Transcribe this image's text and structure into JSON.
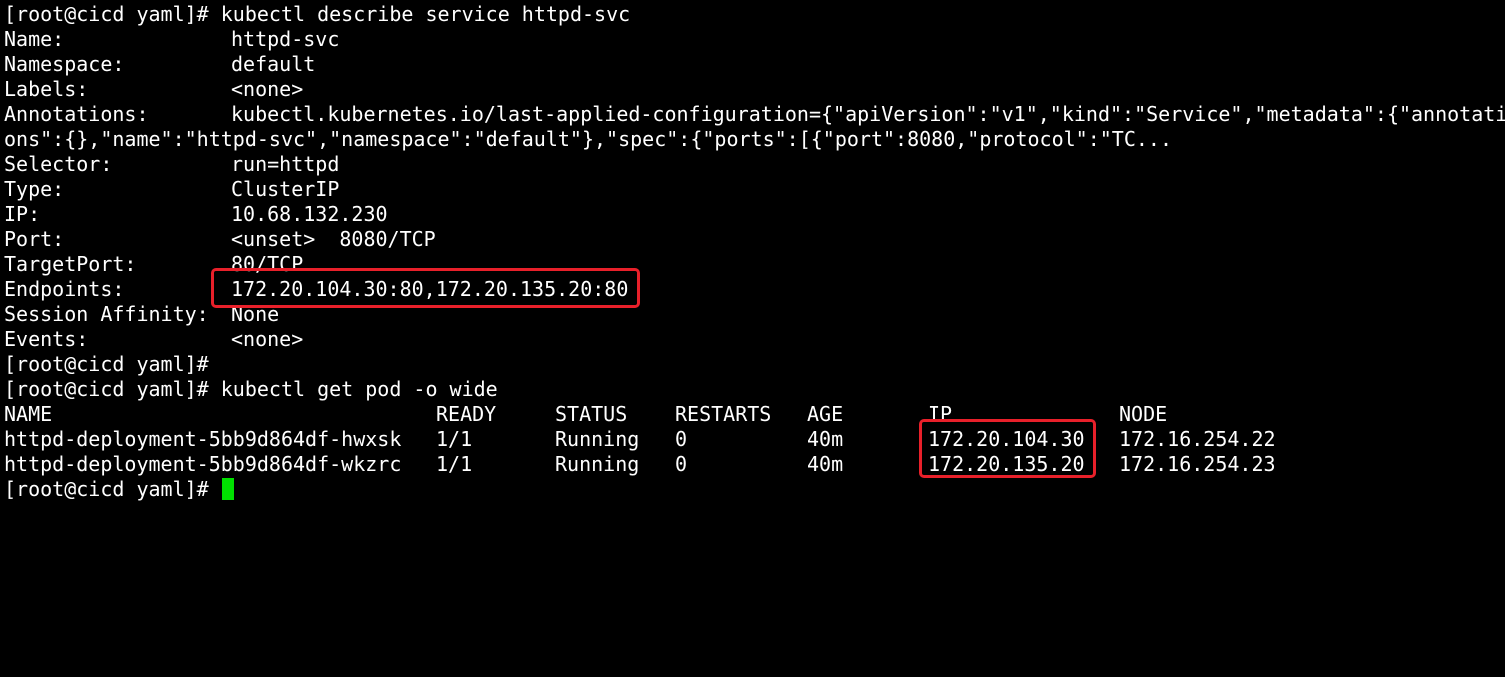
{
  "terminal": {
    "prompt": "[root@cicd yaml]#",
    "cmd_describe": "kubectl describe service httpd-svc",
    "cmd_get_pod": "kubectl get pod -o wide"
  },
  "service": {
    "name_key": "Name:",
    "name_val": "httpd-svc",
    "namespace_key": "Namespace:",
    "namespace_val": "default",
    "labels_key": "Labels:",
    "labels_val": "<none>",
    "annotations_key": "Annotations:",
    "annotations_val": "kubectl.kubernetes.io/last-applied-configuration={\"apiVersion\":\"v1\",\"kind\":\"Service\",\"metadata\":{\"annotati",
    "annotations_cont": "ons\":{},\"name\":\"httpd-svc\",\"namespace\":\"default\"},\"spec\":{\"ports\":[{\"port\":8080,\"protocol\":\"TC...",
    "selector_key": "Selector:",
    "selector_val": "run=httpd",
    "type_key": "Type:",
    "type_val": "ClusterIP",
    "ip_key": "IP:",
    "ip_val": "10.68.132.230",
    "port_key": "Port:",
    "port_val": "<unset>  8080/TCP",
    "targetport_key": "TargetPort:",
    "targetport_val": "80/TCP",
    "endpoints_key": "Endpoints:",
    "endpoints_val": "172.20.104.30:80,172.20.135.20:80",
    "affinity_key": "Session Affinity:",
    "affinity_val": "None",
    "events_key": "Events:",
    "events_val": "<none>"
  },
  "pods": {
    "headers": [
      "NAME",
      "READY",
      "STATUS",
      "RESTARTS",
      "AGE",
      "IP",
      "NODE"
    ],
    "rows": [
      [
        "httpd-deployment-5bb9d864df-hwxsk",
        "1/1",
        "Running",
        "0",
        "40m",
        "172.20.104.30",
        "172.16.254.22"
      ],
      [
        "httpd-deployment-5bb9d864df-wkzrc",
        "1/1",
        "Running",
        "0",
        "40m",
        "172.20.135.20",
        "172.16.254.23"
      ]
    ]
  },
  "colors": {
    "background": "#000000",
    "text": "#ffffff",
    "cursor": "#00e000",
    "highlight": "#e8202a"
  }
}
